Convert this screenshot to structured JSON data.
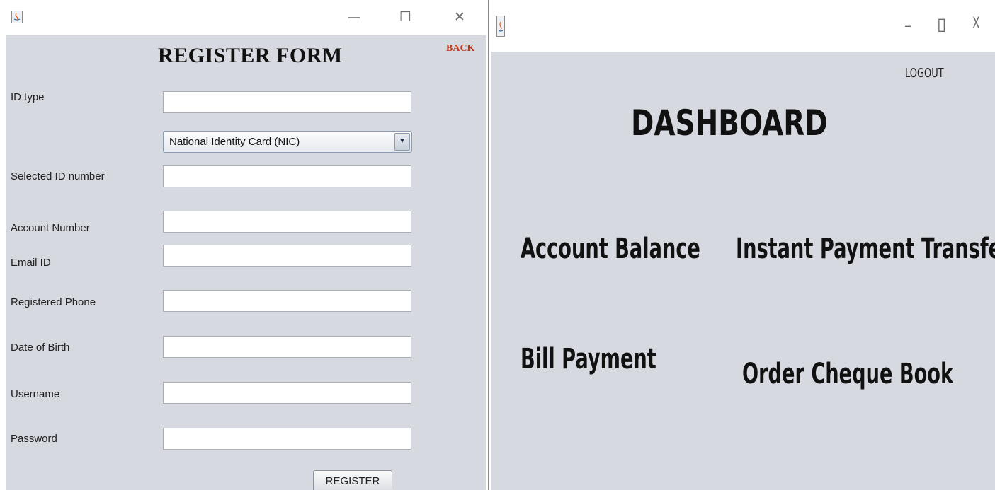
{
  "register_window": {
    "title": "REGISTER FORM",
    "back_label": "BACK",
    "id_type_label": "ID type",
    "id_type_value": "",
    "id_type_select": "National Identity Card (NIC)",
    "fields": [
      {
        "label": "Selected ID number",
        "value": ""
      },
      {
        "label": "Account Number",
        "value": ""
      },
      {
        "label": "Email  ID",
        "value": ""
      },
      {
        "label": "Registered Phone",
        "value": ""
      },
      {
        "label": "Date of Birth",
        "value": ""
      },
      {
        "label": "Username",
        "value": ""
      },
      {
        "label": "Password",
        "value": ""
      }
    ],
    "register_label": "REGISTER",
    "window_controls": {
      "minimize": "—",
      "maximize": "☐",
      "close": "✕"
    }
  },
  "dashboard_window": {
    "title": "DASHBOARD",
    "logout_label": "LOGOUT",
    "items": [
      "Account Balance",
      "Instant Payment Transfer",
      "Bill Payment",
      "Order Cheque Book"
    ],
    "window_controls": {
      "minimize": "–",
      "maximize": "▯",
      "close": "X"
    }
  },
  "icons": [
    "java-app-icon",
    "minimize-icon",
    "maximize-icon",
    "close-icon",
    "dropdown-arrow-icon"
  ],
  "colors": {
    "panel_bg": "#d6d9e0",
    "back_link": "#c0391b",
    "text": "#111111"
  }
}
